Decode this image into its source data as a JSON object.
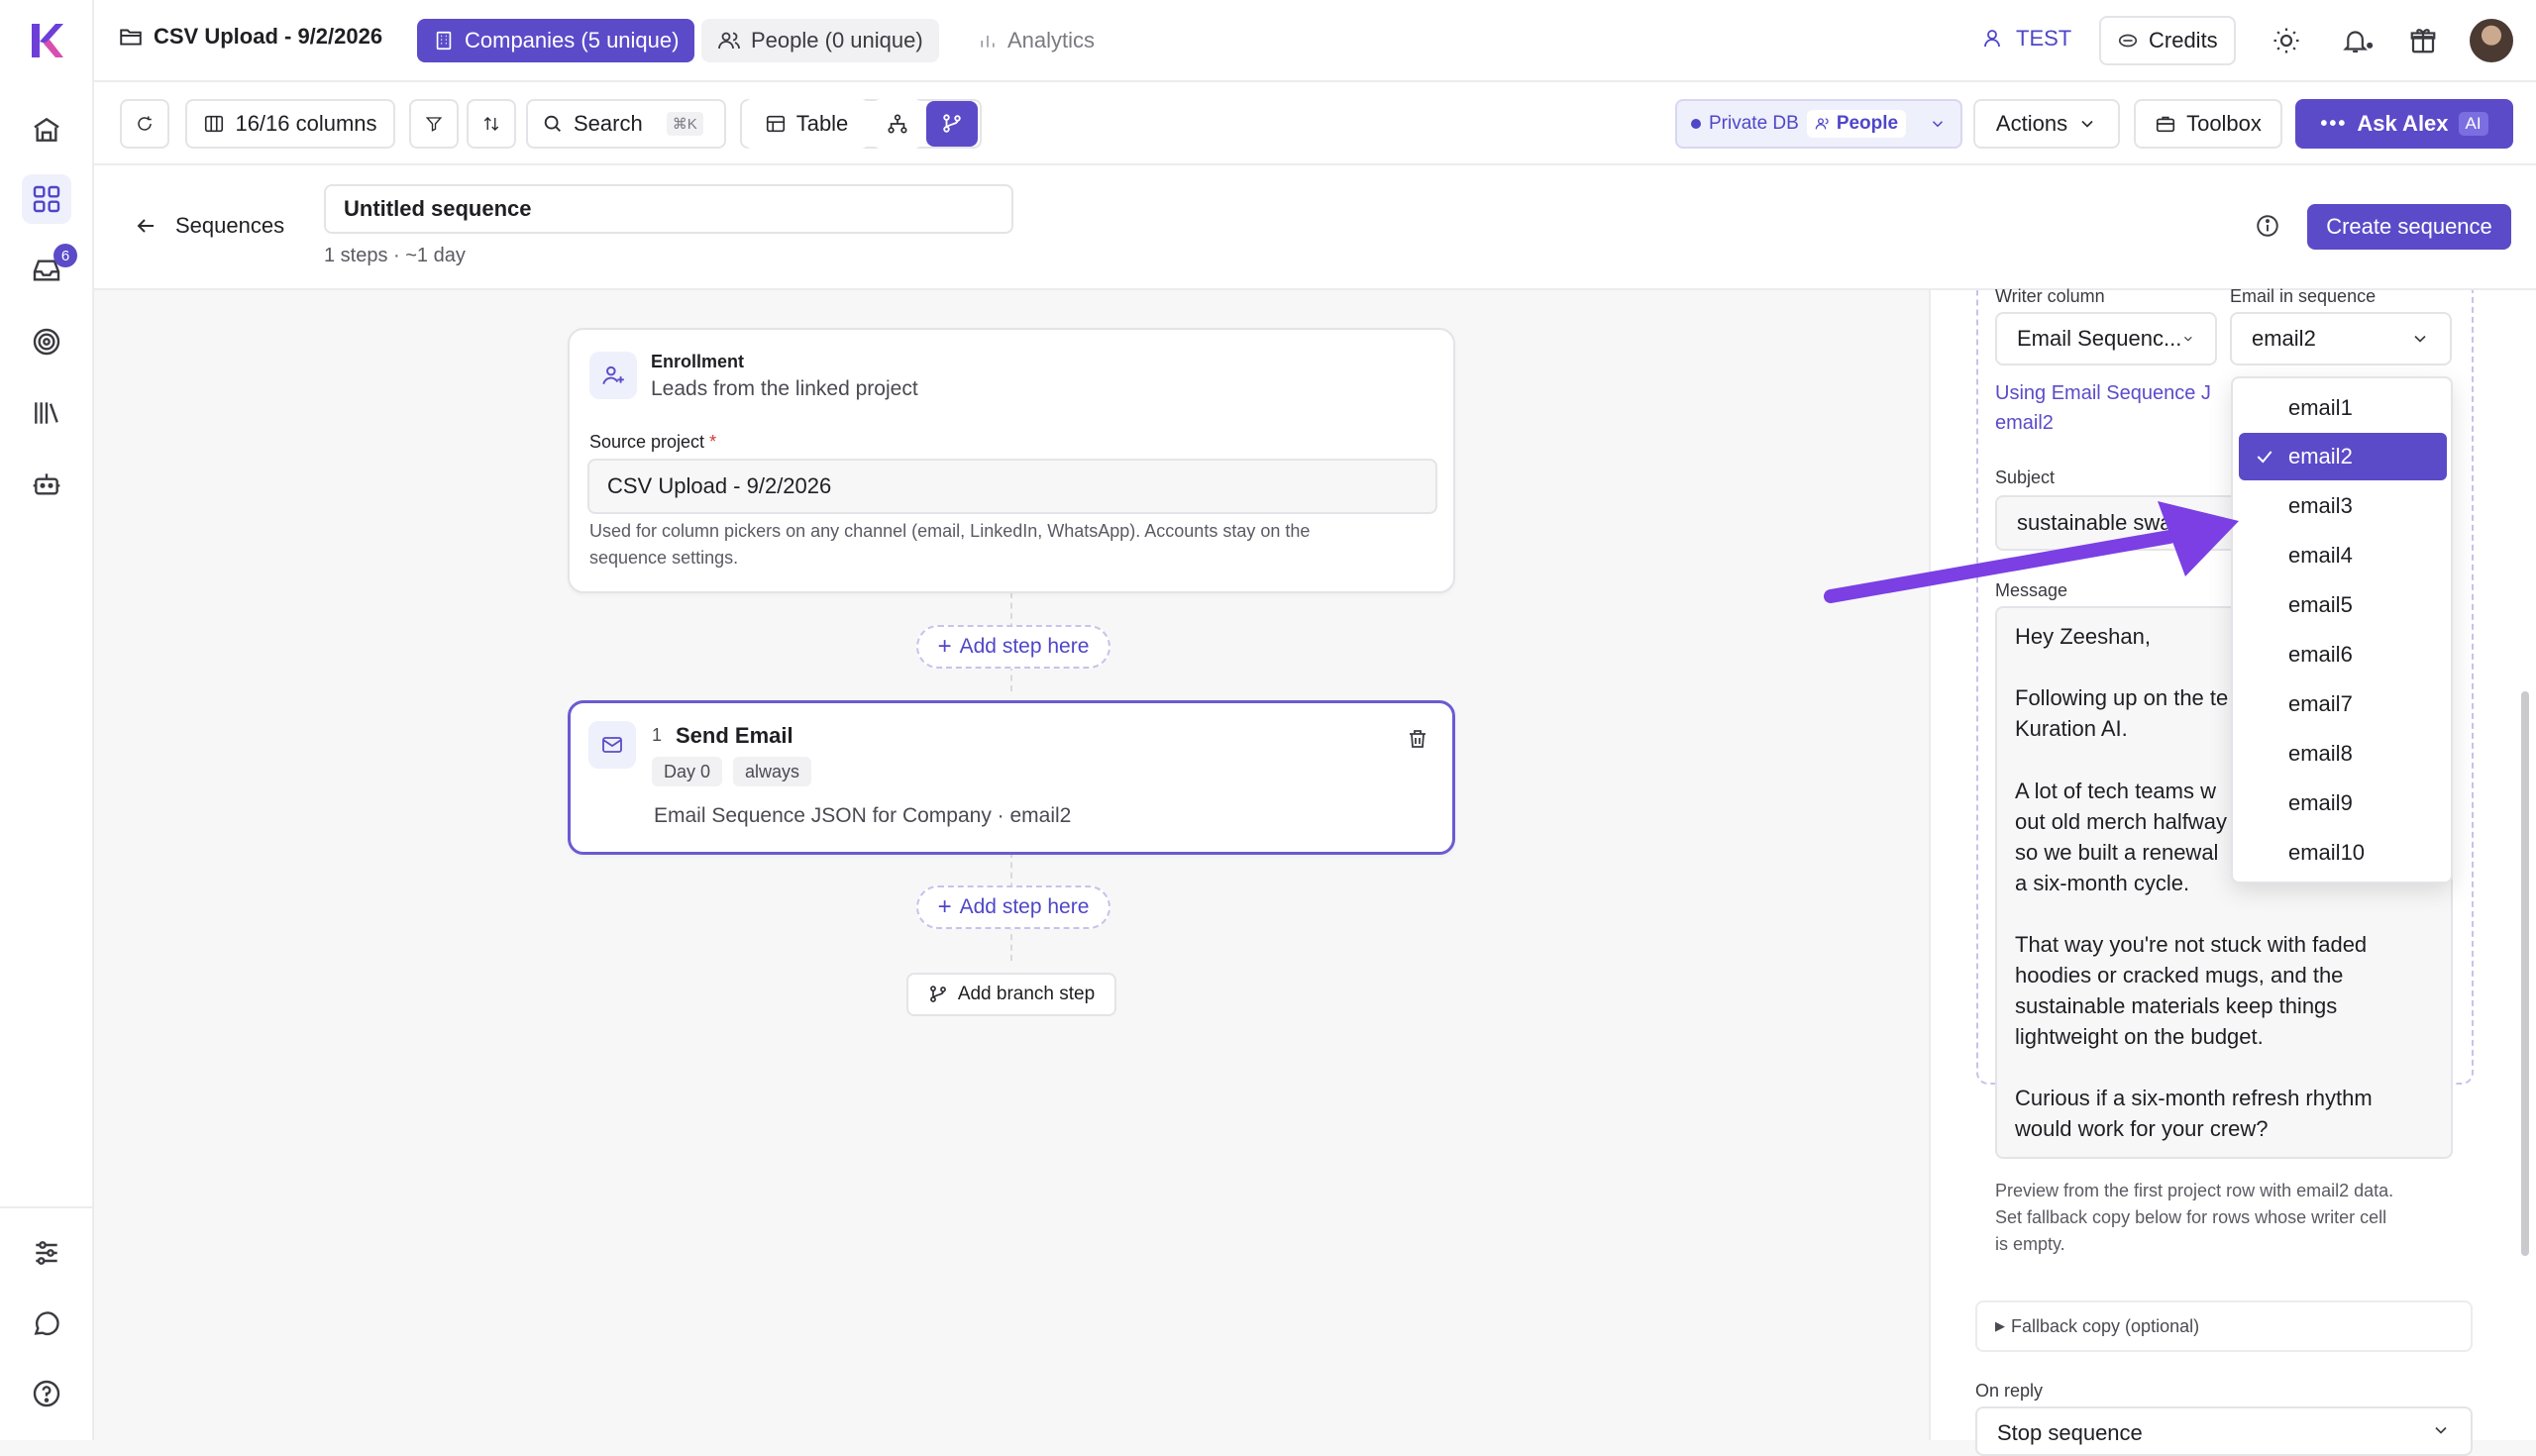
{
  "topbar": {
    "project_title": "CSV Upload - 9/2/2026",
    "tab_companies": "Companies (5 unique)",
    "tab_people": "People (0 unique)",
    "tab_analytics": "Analytics",
    "workspace": "TEST",
    "credits": "Credits"
  },
  "rail": {
    "inbox_badge": "6"
  },
  "toolbar": {
    "columns": "16/16 columns",
    "search": "Search",
    "search_shortcut": "⌘K",
    "table": "Table",
    "private_db": "Private DB",
    "people": "People",
    "actions": "Actions",
    "toolbox": "Toolbox",
    "ask_alex": "Ask Alex",
    "ai_badge": "AI"
  },
  "sequence_header": {
    "back_label": "Sequences",
    "name_value": "Untitled sequence",
    "meta": "1 steps · ~1 day",
    "create_button": "Create sequence"
  },
  "enrollment": {
    "title": "Enrollment",
    "subtitle": "Leads from the linked project",
    "source_label": "Source project",
    "required_mark": "*",
    "source_value": "CSV Upload - 9/2/2026",
    "help_line1": "Used for column pickers on any channel (email, LinkedIn, WhatsApp). Accounts stay on the",
    "help_line2": "sequence settings."
  },
  "add_step_label": "Add step here",
  "step": {
    "number": "1",
    "title": "Send Email",
    "day_badge": "Day 0",
    "cond_badge": "always",
    "description": "Email Sequence JSON for Company · email2"
  },
  "add_branch_label": "Add branch step",
  "panel": {
    "writer_label": "Writer column",
    "writer_value": "Email Sequenc...",
    "email_label": "Email in sequence",
    "email_value": "email2",
    "using_line1": "Using Email Sequence J",
    "using_line2": "email2",
    "subject_label": "Subject",
    "subject_value": "sustainable swa",
    "message_label": "Message",
    "message_lines": [
      "Hey Zeeshan,",
      "Following up on the te",
      "Kuration AI.",
      "A lot of tech teams w",
      "out old merch halfway",
      "so we built a renewal",
      "a six-month cycle.",
      "That way you're not stuck with faded",
      "hoodies or cracked mugs, and the",
      "sustainable materials keep things",
      "lightweight on the budget.",
      "Curious if a six-month refresh rhythm",
      "would work for your crew?"
    ],
    "preview_line1": "Preview from the first project row with email2 data.",
    "preview_line2": "Set fallback copy below for rows whose writer cell",
    "preview_line3": "is empty.",
    "fallback": "Fallback copy (optional)",
    "on_reply_label": "On reply",
    "on_reply_value": "Stop sequence"
  },
  "dropdown": {
    "options": [
      "email1",
      "email2",
      "email3",
      "email4",
      "email5",
      "email6",
      "email7",
      "email8",
      "email9",
      "email10"
    ],
    "selected": "email2"
  },
  "colors": {
    "accent": "#5b4bc9",
    "accent_dark": "#4f46c8",
    "arrow": "#7b3fe4"
  }
}
